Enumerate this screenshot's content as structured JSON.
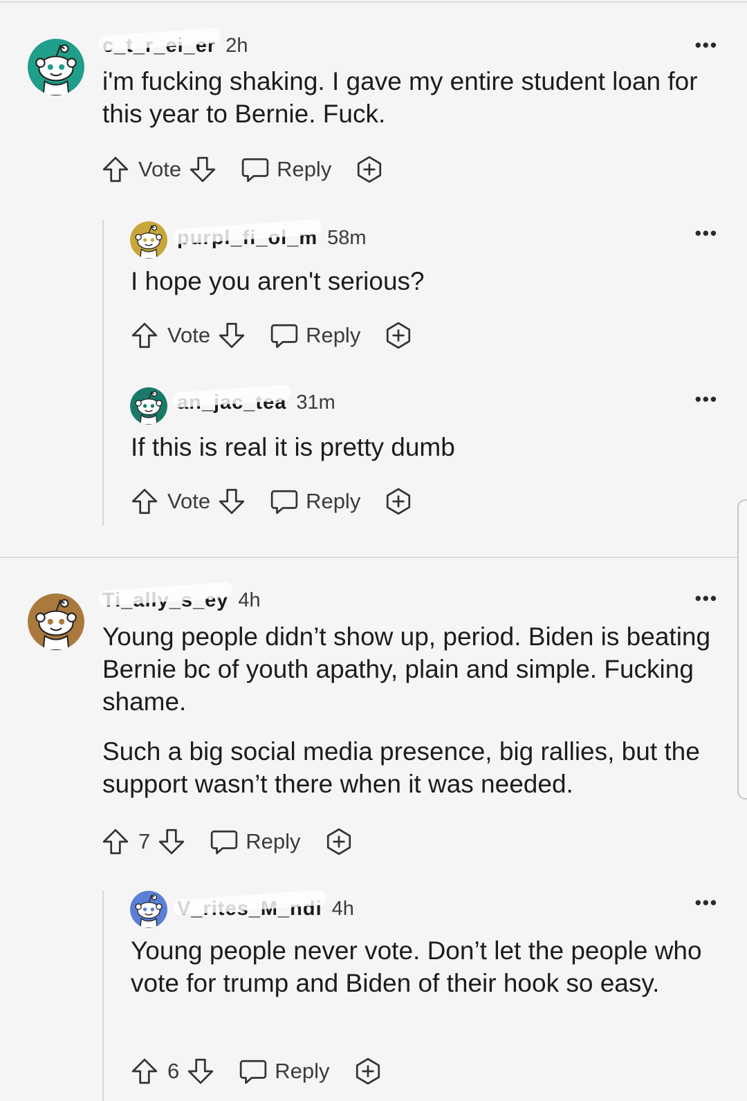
{
  "comments": [
    {
      "username": "c_t_r_ei_er",
      "time": "2h",
      "more": "•••",
      "paragraphs": [
        "i'm fucking shaking. I gave my entire student loan for this year to Bernie. Fuck."
      ],
      "vote_label": "Vote",
      "reply_label": "Reply",
      "avatar_color": "#1f9e8a",
      "replies": [
        {
          "username": "purpl_fi_ol_m",
          "time": "58m",
          "more": "•••",
          "paragraphs": [
            "I hope you aren't serious?"
          ],
          "vote_label": "Vote",
          "reply_label": "Reply",
          "avatar_color": "#c9a63a"
        },
        {
          "username": "an_jac_tea",
          "time": "31m",
          "more": "•••",
          "paragraphs": [
            "If this is real it is pretty dumb"
          ],
          "vote_label": "Vote",
          "reply_label": "Reply",
          "avatar_color": "#1a7a6a"
        }
      ]
    },
    {
      "username": "Ti_ally_s_ey",
      "time": "4h",
      "more": "•••",
      "paragraphs": [
        "Young people didn’t show up, period. Biden is beating Bernie bc of youth apathy, plain and simple. Fucking shame.",
        "Such a big social media presence, big rallies, but the support wasn’t there when it was needed."
      ],
      "vote_label": "7",
      "reply_label": "Reply",
      "avatar_color": "#a97a3c",
      "replies": [
        {
          "username": "V_rites_M_ndi",
          "time": "4h",
          "more": "•••",
          "paragraphs": [
            "Young people never vote. Don’t let the people who vote for trump and Biden of their hook so easy."
          ],
          "vote_label": "6",
          "reply_label": "Reply",
          "avatar_color": "#5b7fd6"
        }
      ]
    }
  ],
  "icons": {
    "upvote": "upvote-arrow-icon",
    "downvote": "downvote-arrow-icon",
    "reply": "speech-bubble-icon",
    "award": "award-plus-icon",
    "more": "more-options-icon",
    "avatar": "snoo-avatar-icon"
  }
}
